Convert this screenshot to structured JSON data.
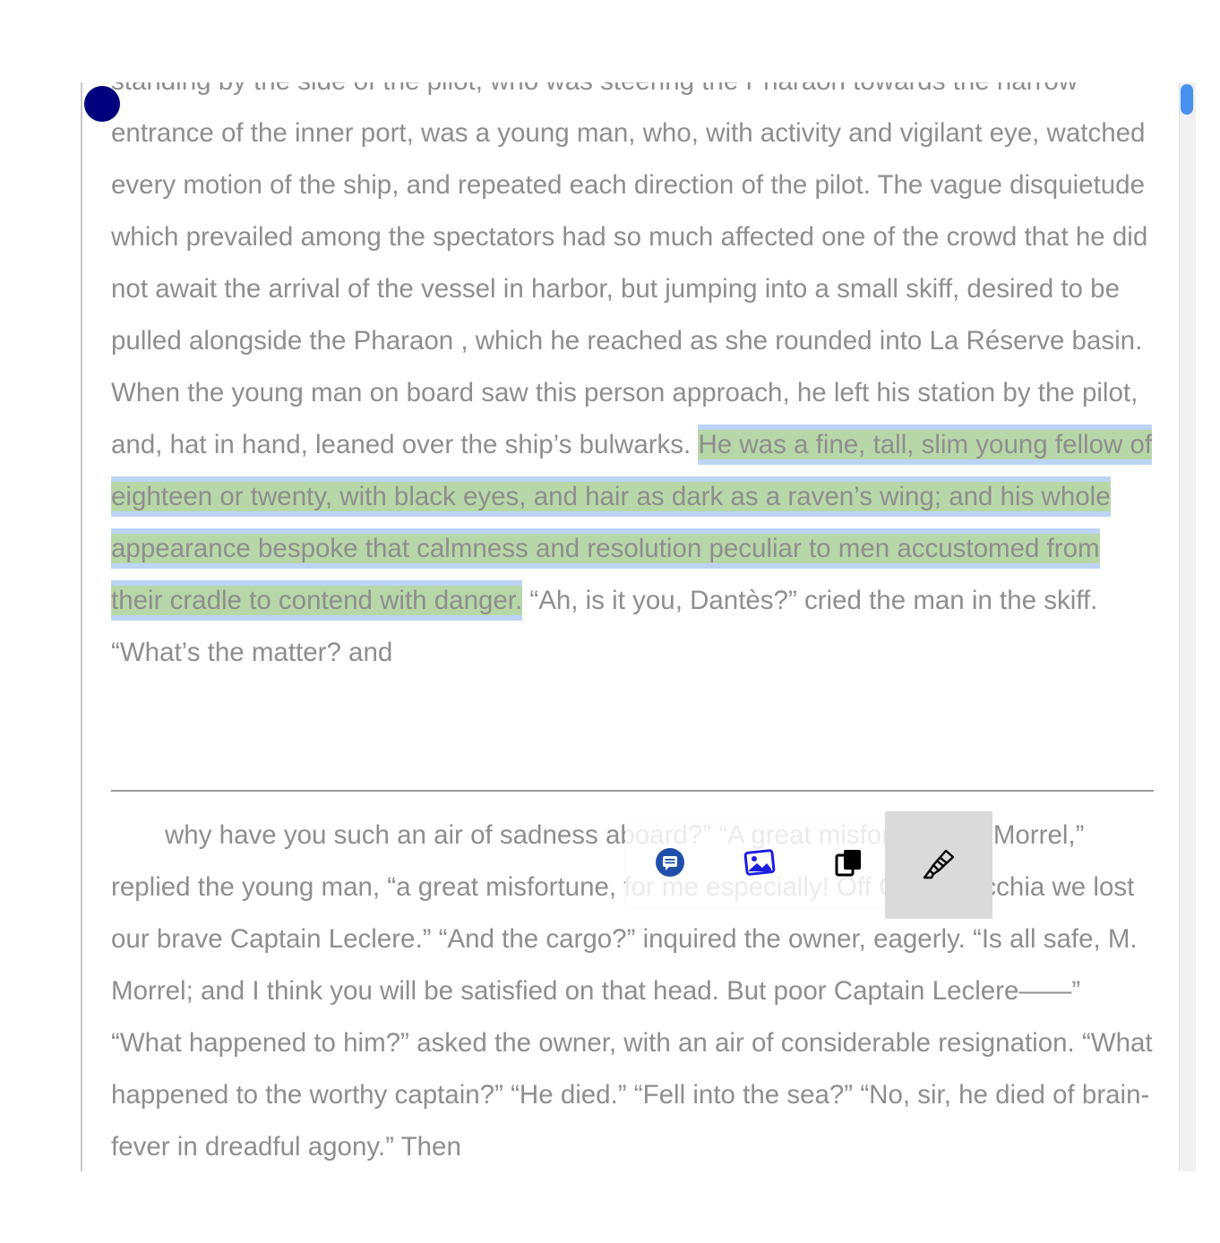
{
  "reader": {
    "page_one": {
      "text_before": "standing by the side of the pilot, who was steering the Pharaon towards the narrow entrance of the inner port, was a young man, who, with activity and vigilant eye, watched every motion of the ship, and repeated each direction of the pilot. The vague disquietude which prevailed among the spectators had so much affected one of the crowd that he did not await the arrival of the vessel in harbor, but jumping into a small skiff, desired to be pulled alongside the Pharaon , which he reached as she rounded into La Réserve basin. When the young man on board saw this person approach, he left his station by the pilot, and, hat in hand, leaned over the ship’s bulwarks. ",
      "highlighted": "He was a fine, tall, slim young fellow of eighteen or twenty, with black eyes, and hair as dark as a raven’s wing; and his whole appearance bespoke that calmness and resolution peculiar to men accustomed from their cradle to contend with danger.",
      "text_after": " “Ah, is it you, Dantès?” cried the man in the skiff. “What’s the matter? and"
    },
    "page_two": {
      "text": "why have you such an air of sadness aboard?” “A great misfortune, M. Morrel,” replied the young man, “a great misfortune, for me especially! Off Civita Vecchia we lost our brave Captain Leclere.” “And the cargo?” inquired the owner, eagerly. “Is all safe, M. Morrel; and I think you will be satisfied on that head. But poor Captain Leclere——” “What happened to him?” asked the owner, with an air of considerable resignation. “What happened to the worthy captain?” “He died.” “Fell into the sea?” “No, sir, he died of brain-fever in dreadful agony.” Then"
    }
  },
  "toolbar": {
    "tools": [
      {
        "icon": "note-icon",
        "color": "#1f4fa8"
      },
      {
        "icon": "image-icon",
        "color": "#1d1de0"
      },
      {
        "icon": "copy-icon",
        "color": "#000000"
      },
      {
        "icon": "highlighter-icon",
        "color": "#000000"
      }
    ]
  },
  "colors": {
    "text": "#8e8e8e",
    "highlight": "#b7d7a8",
    "selection": "#bcd4f6",
    "handle": "#00007f",
    "scroll_thumb": "#4a90f0"
  }
}
